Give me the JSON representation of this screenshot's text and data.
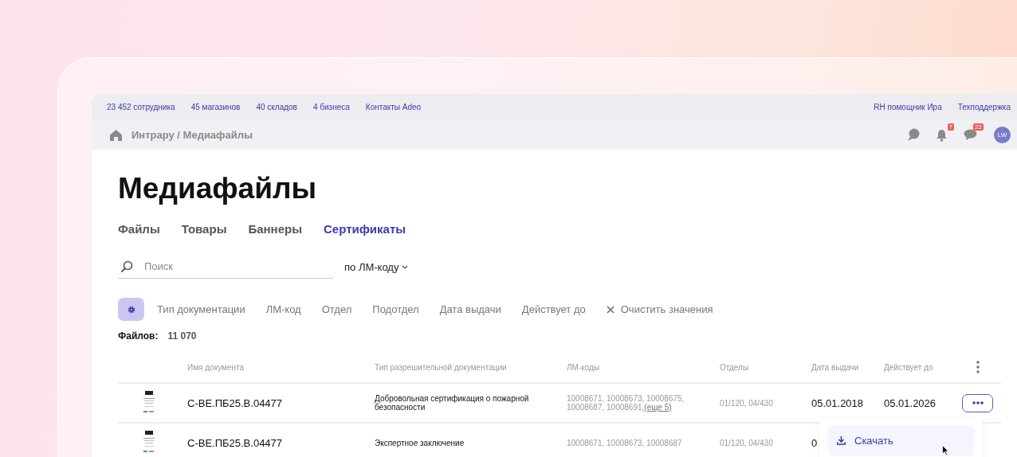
{
  "top_links": [
    "23 452 сотрудника",
    "45 магазинов",
    "40 складов",
    "4 бизнеса",
    "Контакты Adeo"
  ],
  "top_right_links": [
    "RH помощник Ира",
    "Техподдержка"
  ],
  "breadcrumb": "Интрару / Медиафайлы",
  "notifications": {
    "bell_badge": "7",
    "messages_badge": "22",
    "avatar": "LW"
  },
  "title": "Медиафайлы",
  "tabs": [
    {
      "label": "Файлы",
      "selected": false
    },
    {
      "label": "Товары",
      "selected": false
    },
    {
      "label": "Баннеры",
      "selected": false
    },
    {
      "label": "Сертификаты",
      "selected": true
    }
  ],
  "search": {
    "placeholder": "Поиск",
    "mode": "по ЛМ-коду"
  },
  "filters": [
    "Тип документации",
    "ЛМ-код",
    "Отдел",
    "Подотдел",
    "Дата выдачи",
    "Действует до"
  ],
  "clear_filters": "Очистить значения",
  "files_count": {
    "label": "Файлов:",
    "value": "11 070"
  },
  "table": {
    "columns": [
      "Имя документа",
      "Тип разрешительной документации",
      "ЛМ-коды",
      "Отделы",
      "Дата выдачи",
      "Действует до"
    ],
    "rows": [
      {
        "name": "С-ВЕ.ПБ25.В.04477",
        "type": "Добровольная сертификация о пожарной безопасности",
        "codes": "10008671, 10008673, 10008675, 10008687, 10008691,",
        "more": "(еще 5)",
        "departments": "01/120, 04/430",
        "issued": "05.01.2018",
        "valid_until": "05.01.2026",
        "menu_open": true
      },
      {
        "name": "С-ВЕ.ПБ25.В.04477",
        "type": "Экспертное заключение",
        "codes": "10008671, 10008673, 10008687",
        "departments": "01/120, 04/430",
        "issued": "0",
        "menu_open": false
      }
    ]
  },
  "row_menu": {
    "items": [
      "Скачать"
    ]
  }
}
